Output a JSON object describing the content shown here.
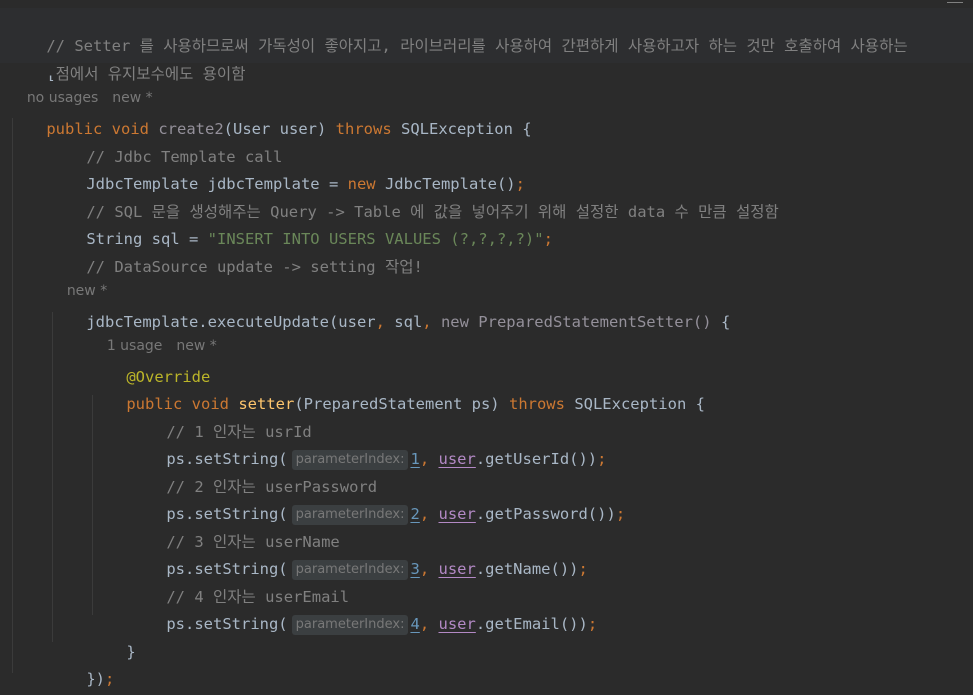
{
  "top_comment": {
    "line1": "// Setter 를 사용하므로써 가독성이 좋아지고, 라이브러리를 사용하여 간편하게 사용하고자 하는 것만 호출하여 사용하는",
    "line2": "점에서 유지보수에도 용이함"
  },
  "hints": {
    "method_usages": "no usages",
    "method_new": "new *",
    "anon_new": "new *",
    "setter_usages": "1 usage",
    "setter_new": "new *"
  },
  "code": {
    "kw_public": "public",
    "kw_void": "void",
    "method_name": "create2",
    "method_params": "(User user) ",
    "kw_throws": "throws",
    "exception": " SQLException {",
    "comment_template": "// Jdbc Template call",
    "template_decl": "JdbcTemplate jdbcTemplate = ",
    "kw_new": "new",
    "template_ctor": " JdbcTemplate()",
    "semicolon": ";",
    "comment_sql": "// SQL 문을 생성해주는 Query -> Table 에 값을 넣어주기 위해 설정한 data 수 만큼 설정함",
    "sql_decl": "String sql = ",
    "sql_string": "\"INSERT INTO USERS VALUES (?,?,?,?)\"",
    "comment_datasource": "// DataSource update -> setting 작업!",
    "exec_call": "jdbcTemplate.executeUpdate(user",
    "exec_sql": " sql",
    "comma": ",",
    "anon_class": " new PreparedStatementSetter()",
    "open_brace": " {",
    "annotation": "@Override",
    "setter_name": "setter",
    "setter_params": "(PreparedStatement ps) ",
    "close_brace": "}",
    "close_call": "})",
    "ps_set_string": "ps.setString(",
    "param_hint": "parameterIndex:",
    "user_ref": "user",
    "statements": [
      {
        "comment": "// 1 인자는 usrId",
        "index": "1",
        "getter": ".getUserId())"
      },
      {
        "comment": "// 2 인자는 userPassword",
        "index": "2",
        "getter": ".getPassword())"
      },
      {
        "comment": "// 3 인자는 userName",
        "index": "3",
        "getter": ".getName())"
      },
      {
        "comment": "// 4 인자는 userEmail",
        "index": "4",
        "getter": ".getEmail())"
      }
    ]
  },
  "colors": {
    "background": "#2b2b2b",
    "keyword": "#cc7832",
    "comment": "#808080",
    "string": "#6a8759",
    "annotation": "#bbb529",
    "method": "#ffc66d",
    "number": "#6897bb",
    "parameter": "#b389c5",
    "text": "#a9b7c6"
  }
}
